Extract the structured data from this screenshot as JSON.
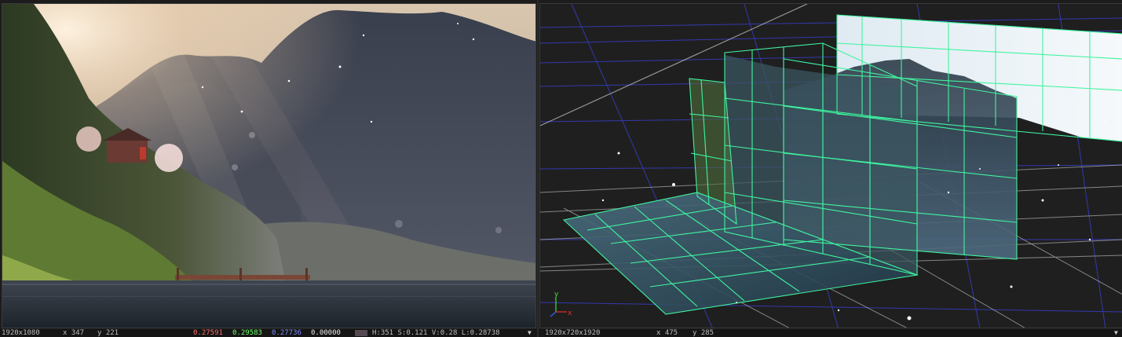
{
  "left_status": {
    "resolution": "1920x1080",
    "x": "x 347",
    "y": "y 221",
    "red": "0.27591",
    "green": "0.29583",
    "blue": "0.27736",
    "alpha": "0.00000",
    "hsvl": "H:351 S:0.121 V:0.28 L:0.28738"
  },
  "right_status": {
    "resolution": "1920x720x1920",
    "x": "x 475",
    "y": "y 285"
  },
  "colors": {
    "wireframe": "#3ff4a0",
    "grid_blue": "#3a3fd0",
    "grid_white": "#d8d8d8",
    "sky_glow": "#f2d6b6"
  }
}
